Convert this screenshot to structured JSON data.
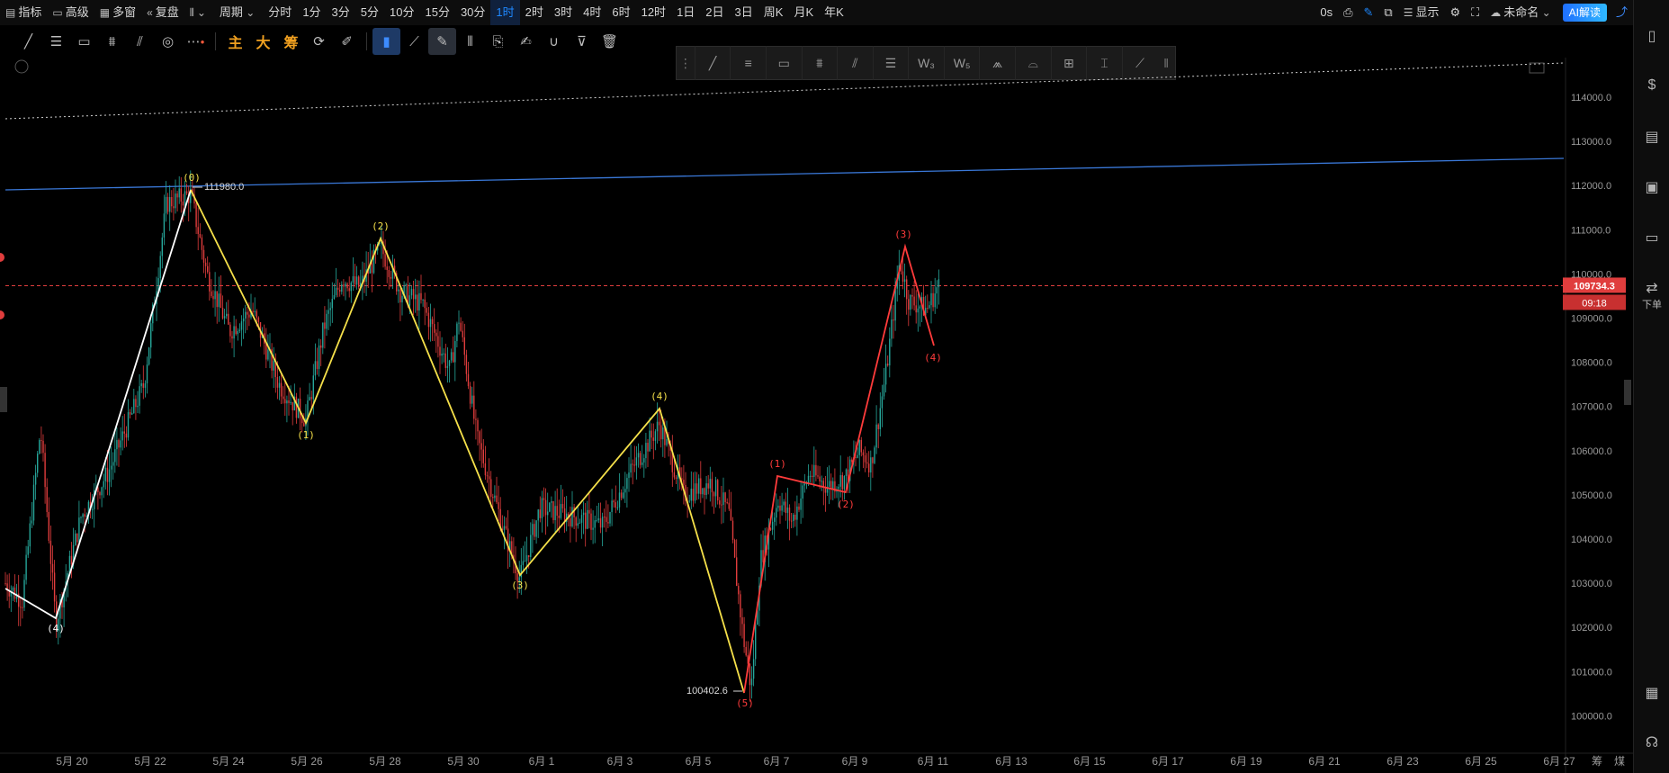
{
  "topbar": {
    "indicator": "指标",
    "advanced": "高级",
    "multi_window": "多窗",
    "replay": "复盘",
    "period": "周期",
    "timeframes": [
      "分时",
      "1分",
      "3分",
      "5分",
      "10分",
      "15分",
      "30分",
      "1时",
      "2时",
      "3时",
      "4时",
      "6时",
      "12时",
      "1日",
      "2日",
      "3日",
      "周K",
      "月K",
      "年K"
    ],
    "active_timeframe": "1时",
    "countdown": "0s",
    "display": "显示",
    "unnamed": "未命名",
    "ai_button": "AI解读"
  },
  "toolbar2": {
    "tools": [
      "line-tool",
      "horizontal-lines-tool",
      "rectangle-tool",
      "price-range-tool",
      "fib-tool",
      "circle-tool",
      "more-tool"
    ],
    "cn_tools": [
      "主",
      "大",
      "筹"
    ]
  },
  "chart": {
    "price_labels": [
      "114000.0",
      "113000.0",
      "112000.0",
      "111000.0",
      "110000.0",
      "109000.0",
      "108000.0",
      "107000.0",
      "106000.0",
      "105000.0",
      "104000.0",
      "103000.0",
      "102000.0",
      "101000.0",
      "100000.0"
    ],
    "date_labels": [
      "5月 20",
      "5月 22",
      "5月 24",
      "5月 26",
      "5月 28",
      "5月 30",
      "6月 1",
      "6月 3",
      "6月 5",
      "6月 7",
      "6月 9",
      "6月 11",
      "6月 13",
      "6月 15",
      "6月 17",
      "6月 19",
      "6月 21",
      "6月 23",
      "6月 25",
      "6月 27"
    ],
    "current_price": "109734.3",
    "countdown_timer": "09:18",
    "high_annotation": "111980.0",
    "low_annotation": "100402.6",
    "bottom_right": [
      "筹",
      "煤"
    ],
    "colors": {
      "up": "#26a69a",
      "down": "#e03d3d",
      "wave_white": "#ffffff",
      "wave_yellow": "#f5e04a",
      "wave_red": "#ff3b3b",
      "trend_blue": "#3a78d8",
      "price_tag": "#e03d3d"
    },
    "white_wave": [
      {
        "label": "(4)",
        "date": "5月 20",
        "price": 102000
      }
    ],
    "yellow_wave": [
      {
        "label": "(0)",
        "price": 111980
      },
      {
        "label": "(1)",
        "price": 106600
      },
      {
        "label": "(2)",
        "price": 110800
      },
      {
        "label": "(3)",
        "price": 103100
      },
      {
        "label": "(4)",
        "price": 106900
      },
      {
        "label": "(5)",
        "price": 100402.6
      }
    ],
    "red_wave": [
      {
        "label": "(1)",
        "price": 105300
      },
      {
        "label": "(2)",
        "price": 105000
      },
      {
        "label": "(3)",
        "price": 110600
      },
      {
        "label": "(4)",
        "price": 108300
      }
    ]
  },
  "rightbar": {
    "order_label": "下单"
  }
}
